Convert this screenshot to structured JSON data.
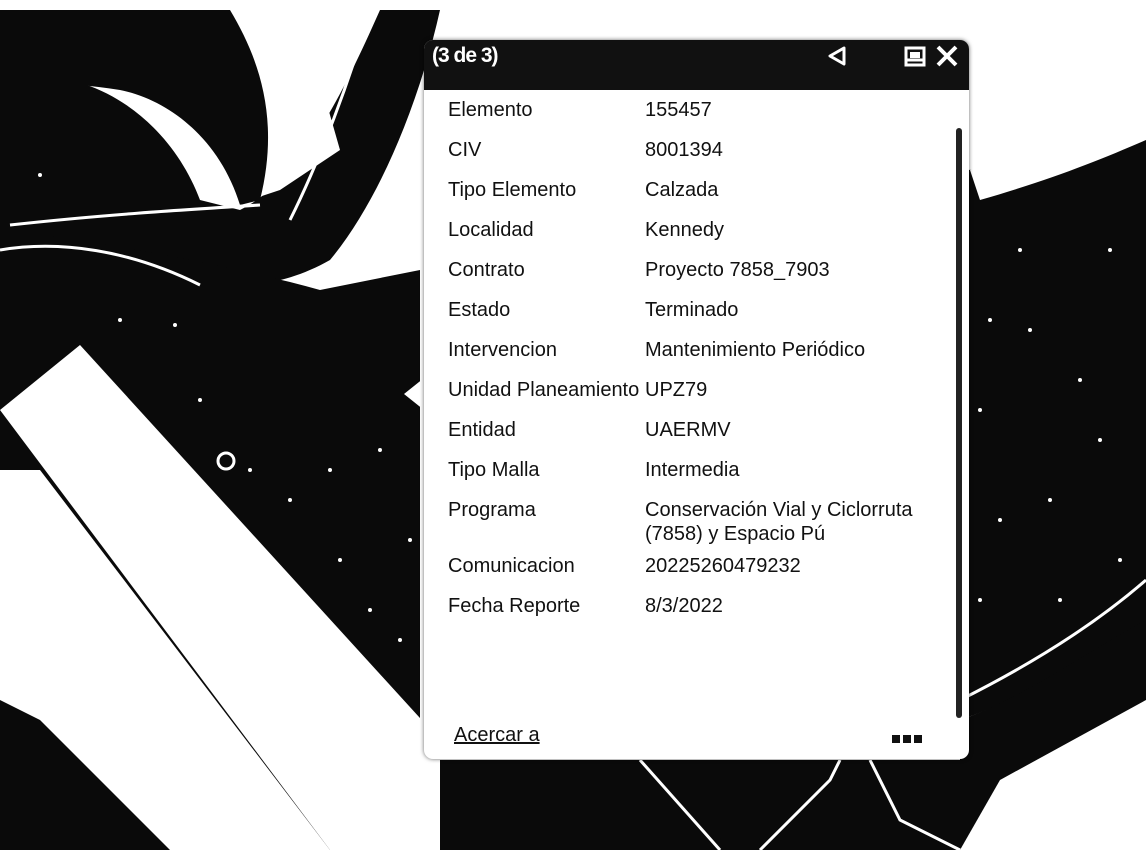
{
  "popup": {
    "counter": "(3 de 3)",
    "icons": {
      "previous": "triangle-left-icon",
      "dock": "dock-icon",
      "close": "close-x-icon"
    },
    "fields": [
      {
        "label": "Elemento",
        "value": "155457"
      },
      {
        "label": "CIV",
        "value": "8001394"
      },
      {
        "label": "Tipo Elemento",
        "value": "Calzada"
      },
      {
        "label": "Localidad",
        "value": "Kennedy"
      },
      {
        "label": "Contrato",
        "value": "Proyecto 7858_7903"
      },
      {
        "label": "Estado",
        "value": "Terminado"
      },
      {
        "label": "Intervencion",
        "value": "Mantenimiento Periódico"
      },
      {
        "label": "Unidad Planeamiento",
        "value": "UPZ79"
      },
      {
        "label": "Entidad",
        "value": "UAERMV"
      },
      {
        "label": "Tipo Malla",
        "value": "Intermedia"
      },
      {
        "label": "Programa",
        "value": "Conservación Vial y Ciclorruta (7858) y Espacio Pú"
      },
      {
        "label": "Comunicacion",
        "value": "20225260479232"
      },
      {
        "label": "Fecha Reporte",
        "value": "8/3/2022"
      }
    ],
    "zoom_link": "Acercar a",
    "more_icon": "more-dots-icon"
  },
  "colors": {
    "header": "#111111",
    "background": "#ffffff",
    "map_dark": "#0a0a0a"
  }
}
